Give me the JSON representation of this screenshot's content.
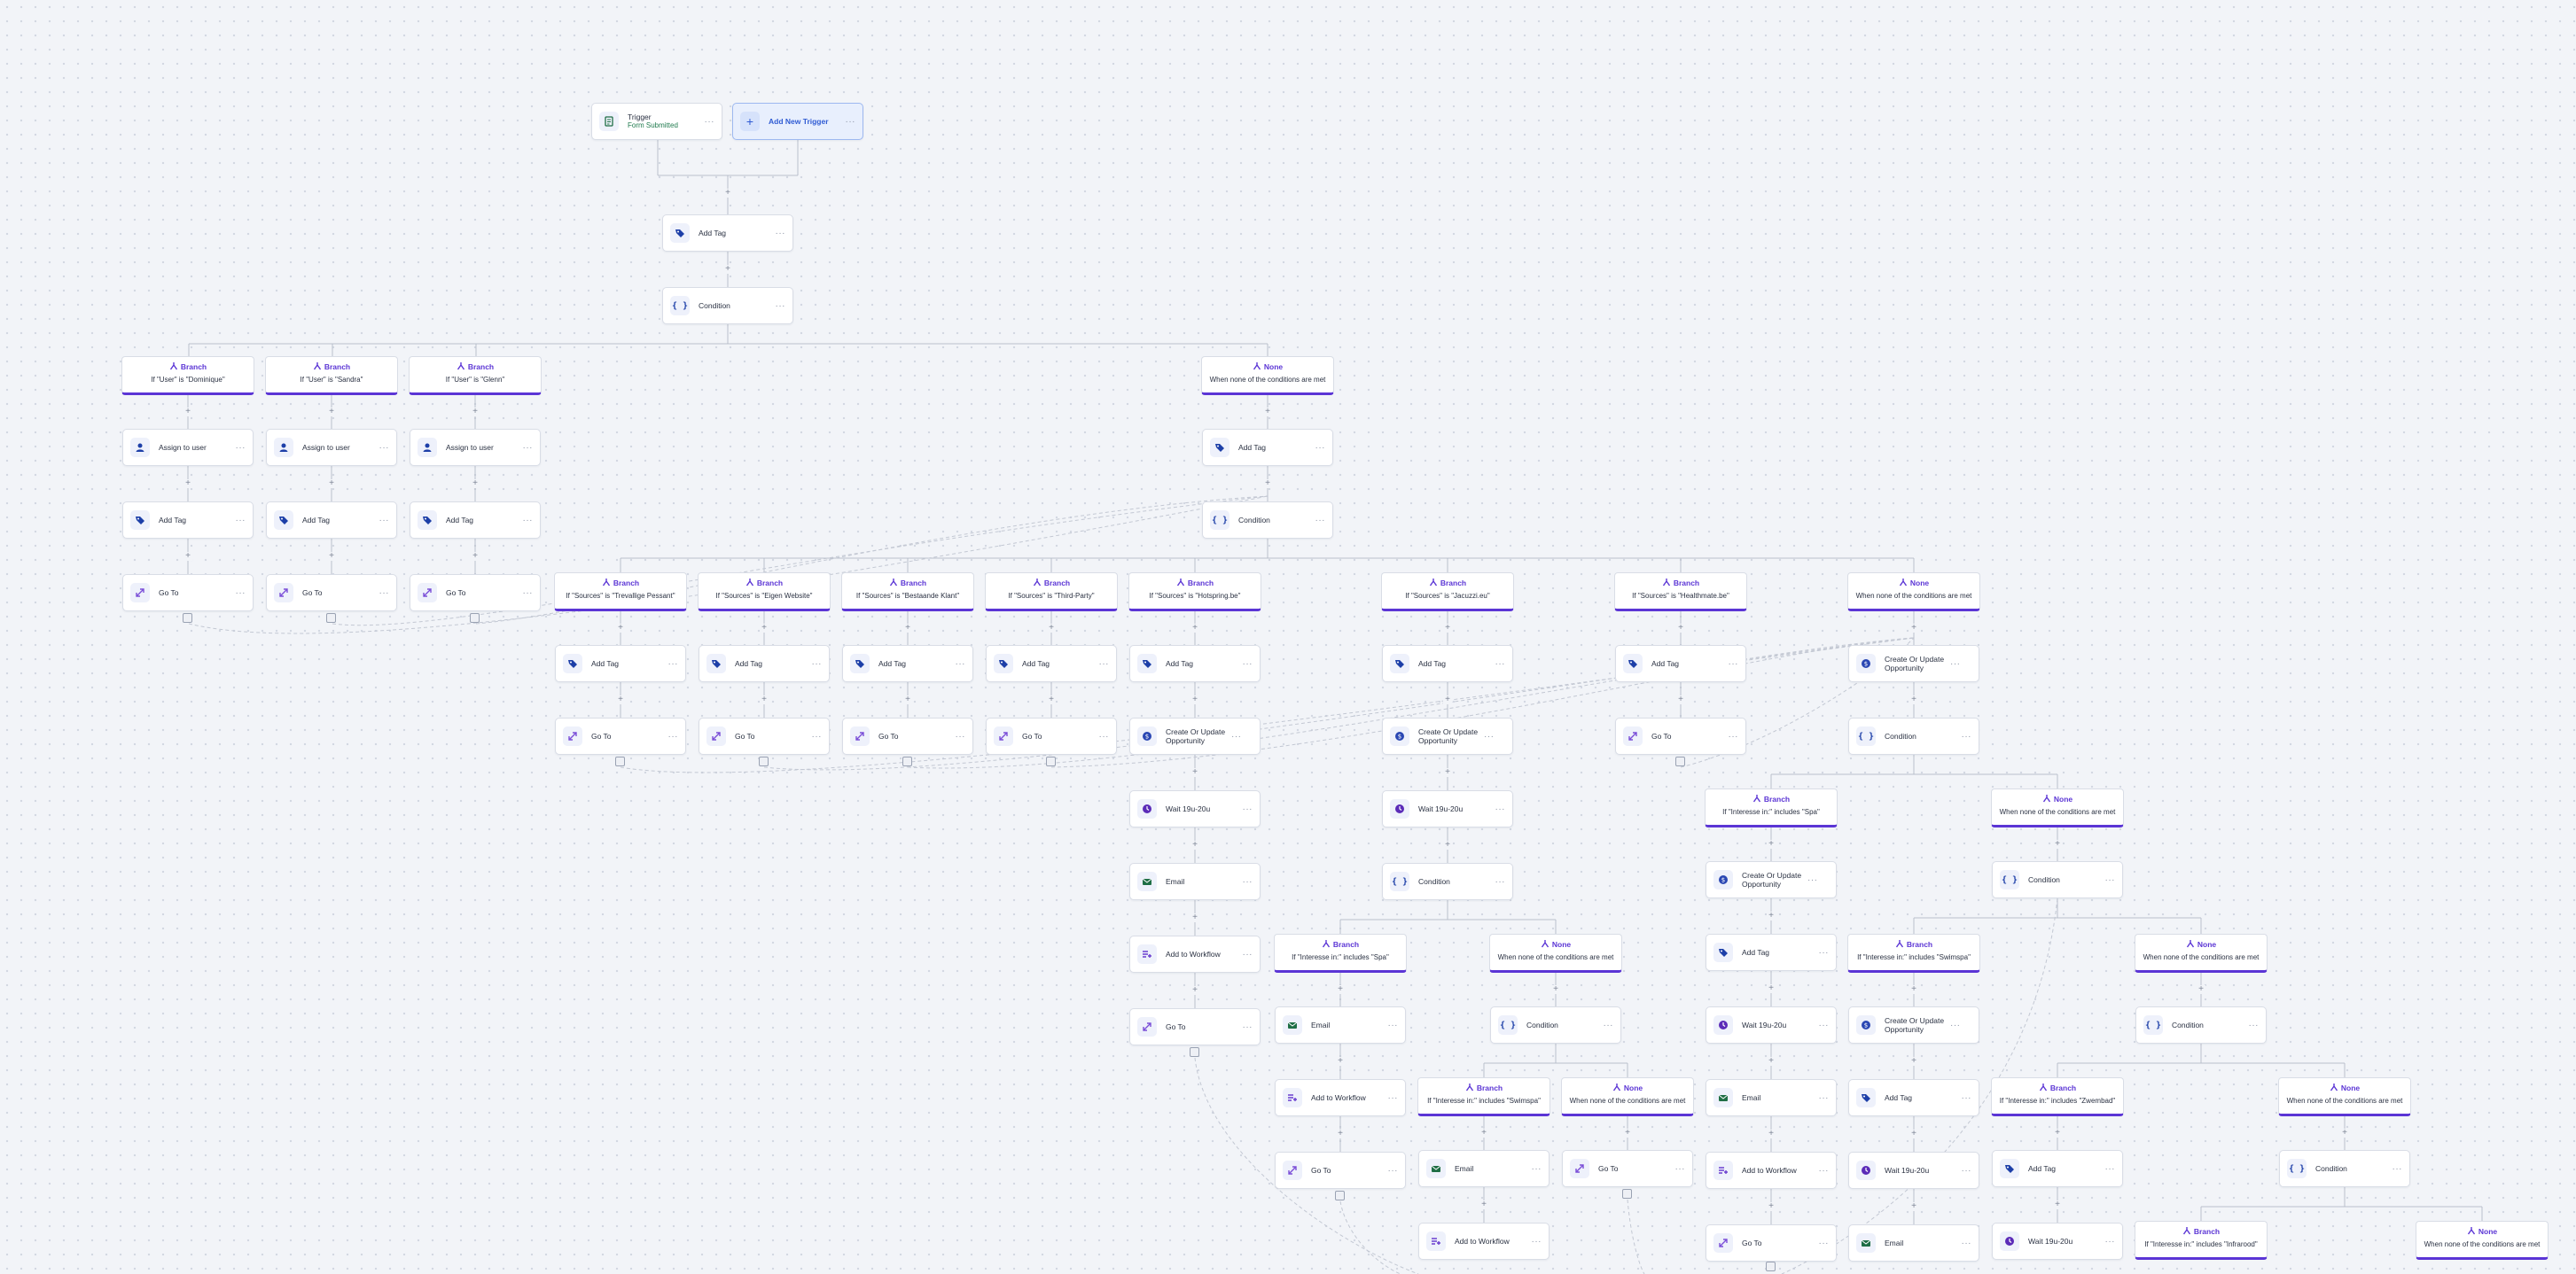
{
  "labels": {
    "trigger": "Trigger",
    "form_submitted": "Form Submitted",
    "add_new_trigger": "Add New Trigger",
    "add_tag": "Add Tag",
    "condition": "Condition",
    "assign_to_user": "Assign to user",
    "go_to": "Go To",
    "create_or_update_opportunity": "Create Or Update Opportunity",
    "wait": "Wait 19u-20u",
    "email": "Email",
    "add_to_workflow": "Add to Workflow",
    "branch": "Branch",
    "none": "None",
    "none_condition": "When none of the conditions are met",
    "menu": "···"
  },
  "conditions": {
    "user_dominique": "If \"User\" is \"Dominique\"",
    "user_sandra": "If \"User\" is \"Sandra\"",
    "user_glenn": "If \"User\" is \"Glenn\"",
    "src_trevallige": "If \"Sources\" is \"Trevallige Pessant\"",
    "src_eigen": "If \"Sources\" is \"Eigen Website\"",
    "src_bestaande": "If \"Sources\" is \"Bestaande Klant\"",
    "src_third": "If \"Sources\" is \"Third-Party\"",
    "src_hottspring": "If \"Sources\" is \"Hotspring.be\"",
    "src_jacuzzi": "If \"Sources\" is \"Jacuzzi.eu\"",
    "src_healthmate": "If \"Sources\" is \"Healthmate.be\"",
    "int_spa_a": "If \"Interesse in:\" includes \"Spa\"",
    "int_spa_b": "If \"Interesse in:\" includes \"Spa\"",
    "int_swimspa_a": "If \"Interesse in:\" includes \"Swimspa\"",
    "int_swimspa_b": "If \"Interesse in:\" includes \"Swimspa\"",
    "int_zwembad": "If \"Interesse in:\" includes \"Zwembad\"",
    "int_infrarood": "If \"Interesse in:\" includes \"Infrarood\""
  },
  "colors": {
    "branch_accent": "#5b35d5",
    "tag_icon": "#1d3fa8",
    "goto_icon": "#7b4fd8",
    "opportunity_icon": "#2a47b3",
    "wait_icon": "#5b2bb8",
    "email_icon": "#1f6e45",
    "workflow_icon": "#6a3fd0"
  }
}
